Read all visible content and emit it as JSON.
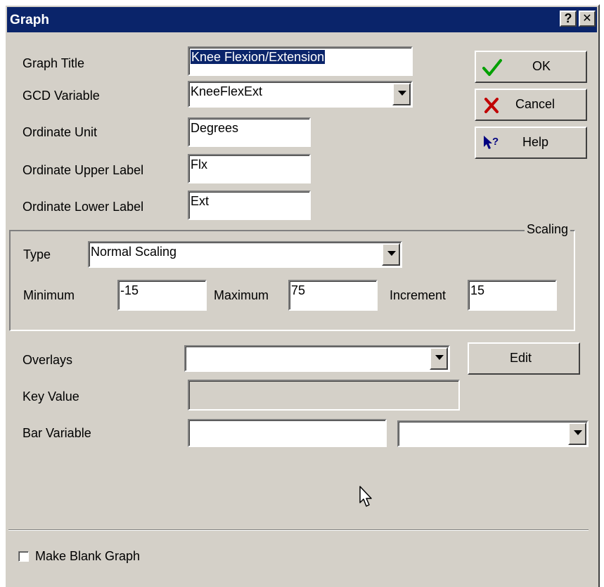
{
  "window": {
    "title": "Graph",
    "help_glyph": "?",
    "close_glyph": "✕"
  },
  "fields": {
    "graph_title": {
      "label": "Graph Title",
      "value": "Knee Flexion/Extension"
    },
    "gcd_variable": {
      "label": "GCD Variable",
      "value": "KneeFlexExt"
    },
    "ordinate_unit": {
      "label": "Ordinate Unit",
      "value": "Degrees"
    },
    "ordinate_upper_label": {
      "label": "Ordinate Upper Label",
      "value": "Flx"
    },
    "ordinate_lower_label": {
      "label": "Ordinate Lower Label",
      "value": "Ext"
    }
  },
  "buttons": {
    "ok": {
      "label": "OK",
      "icon": "checkmark-icon",
      "color": "#00a000"
    },
    "cancel": {
      "label": "Cancel",
      "icon": "cross-icon",
      "color": "#c00000"
    },
    "help": {
      "label": "Help",
      "icon": "help-pointer-icon",
      "color": "#000080"
    },
    "edit": {
      "label": "Edit"
    }
  },
  "scaling": {
    "legend": "Scaling",
    "type_label": "Type",
    "type_value": "Normal Scaling",
    "minimum_label": "Minimum",
    "minimum_value": "-15",
    "maximum_label": "Maximum",
    "maximum_value": "75",
    "increment_label": "Increment",
    "increment_value": "15"
  },
  "lower": {
    "overlays_label": "Overlays",
    "overlays_value": "",
    "key_value_label": "Key Value",
    "key_value_value": "",
    "bar_variable_label": "Bar Variable",
    "bar_variable_value": "",
    "bar_variable_select_value": ""
  },
  "footer": {
    "make_blank_graph_label": "Make Blank Graph",
    "make_blank_graph_checked": false
  },
  "colors": {
    "titlebar": "#0a246a",
    "dialog_face": "#d4d0c8",
    "selection": "#0a246a"
  }
}
